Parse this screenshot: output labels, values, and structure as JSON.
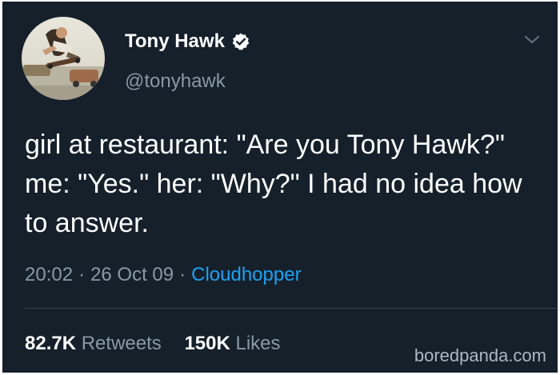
{
  "tweet": {
    "author": {
      "name": "Tony Hawk",
      "handle": "@tonyhawk",
      "verified": true
    },
    "text": "girl at restaurant: \"Are you Tony Hawk?\" me: \"Yes.\" her: \"Why?\" I had no idea how to answer.",
    "time": "20:02",
    "date": "26 Oct 09",
    "separator": "·",
    "source": "Cloudhopper",
    "stats": {
      "retweets_count": "82.7K",
      "retweets_label": "Retweets",
      "likes_count": "150K",
      "likes_label": "Likes"
    }
  },
  "icons": {
    "verified": "verified-badge-icon",
    "menu": "chevron-down-icon"
  },
  "colors": {
    "background": "#15202b",
    "text": "#ffffff",
    "secondary": "#8899a6",
    "link": "#1da1f2",
    "divider": "#38444d"
  },
  "watermark": "boredpanda.com"
}
